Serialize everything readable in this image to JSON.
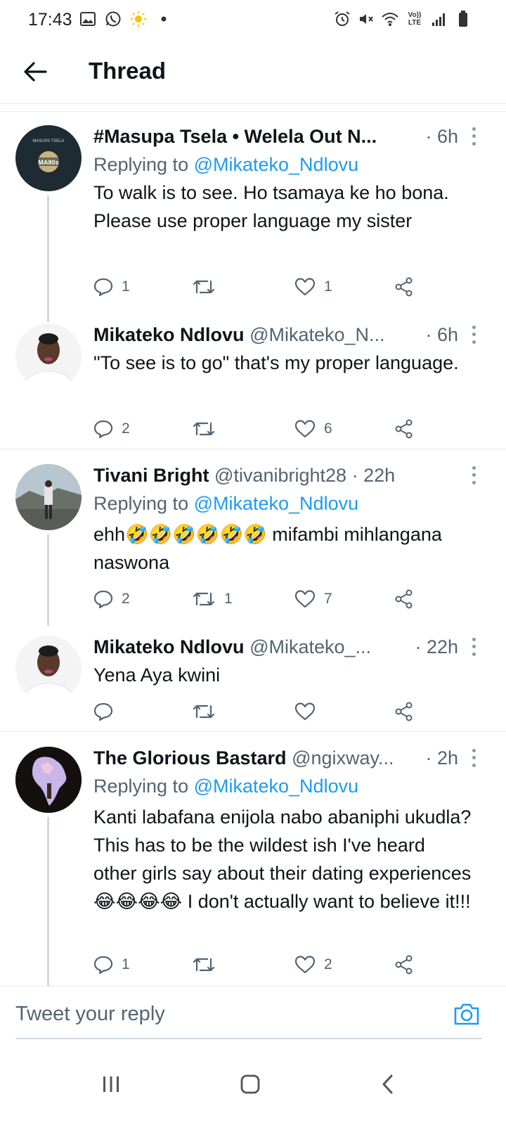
{
  "status_bar": {
    "time": "17:43",
    "left_icons": [
      "gallery-icon",
      "whatsapp-icon",
      "sun-icon",
      "dot-icon"
    ],
    "right_icons": [
      "alarm-icon",
      "mute-icon",
      "wifi-icon",
      "volte-icon",
      "signal-icon",
      "battery-icon"
    ],
    "volte_label_top": "Vo))",
    "volte_label_bottom": "LTE"
  },
  "header": {
    "title": "Thread"
  },
  "tweets": [
    {
      "name": "#Masupa Tsela • Welela Out N...",
      "handle": "",
      "time": "· 6h",
      "replying_prefix": "Replying to ",
      "replying_to": "@Mikateko_Ndlovu",
      "body": "To walk is to see. Ho tsamaya ke ho bona. Please use proper language my sister",
      "avatar_text": "MASUPA TSELA",
      "avatar_badge": "MA80s",
      "replies": "1",
      "retweets": "",
      "likes": "1"
    },
    {
      "name": "Mikateko Ndlovu",
      "handle": "@Mikateko_N...",
      "time": "· 6h",
      "body": "\"To see is to go\" that's my proper language.",
      "replies": "2",
      "retweets": "",
      "likes": "6"
    },
    {
      "name": "Tivani Bright",
      "handle": "@tivanibright28",
      "time": "· 22h",
      "replying_prefix": "Replying to ",
      "replying_to": "@Mikateko_Ndlovu",
      "body": "ehh🤣🤣🤣🤣🤣🤣 mifambi mihlangana naswona",
      "replies": "2",
      "retweets": "1",
      "likes": "7"
    },
    {
      "name": "Mikateko Ndlovu",
      "handle": "@Mikateko_...",
      "time": "· 22h",
      "body": "Yena Aya kwini",
      "replies": "",
      "retweets": "",
      "likes": ""
    },
    {
      "name": "The Glorious Bastard",
      "handle": "@ngixway...",
      "time": "· 2h",
      "replying_prefix": "Replying to ",
      "replying_to": "@Mikateko_Ndlovu",
      "body": "Kanti labafana enijola nabo abaniphi ukudla? This has to be the wildest ish I've heard other girls say about their dating experiences 😂😂😂😂 I don't actually want to believe it!!!",
      "replies": "1",
      "retweets": "",
      "likes": "2"
    }
  ],
  "reply_bar": {
    "placeholder": "Tweet your reply"
  },
  "nav": {
    "buttons": [
      "recent-apps-icon",
      "home-icon",
      "back-icon"
    ]
  },
  "colors": {
    "accent": "#1d9bf0",
    "text": "#0f1419",
    "secondary": "#536471",
    "divider": "#e6ecf0"
  }
}
